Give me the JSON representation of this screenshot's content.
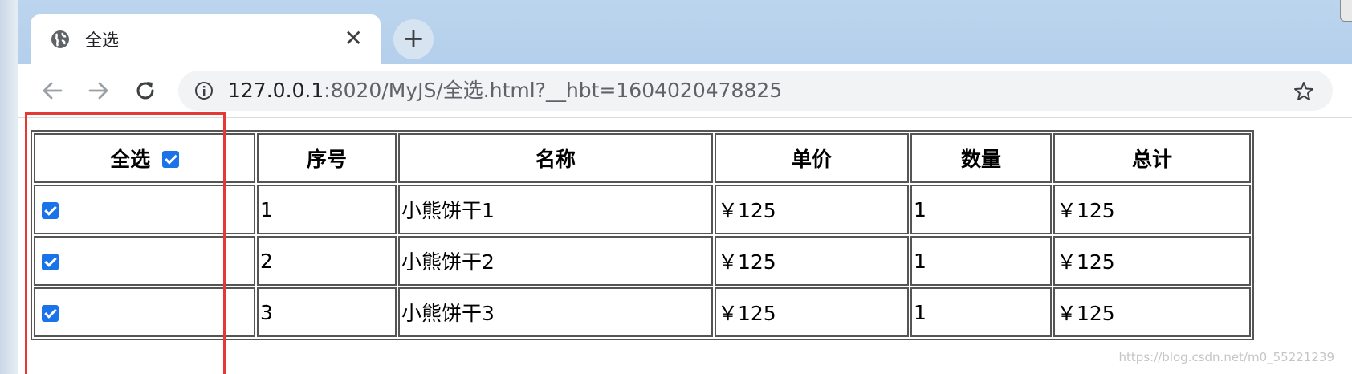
{
  "browser": {
    "tab": {
      "title": "全选",
      "close_glyph": "✕",
      "favicon_icon": "globe-icon"
    },
    "new_tab_glyph": "+",
    "address": {
      "host": "127.0.0.1",
      "path": ":8020/MyJS/全选.html?__hbt=1604020478825"
    }
  },
  "table": {
    "headers": {
      "select_all": "全选",
      "no": "序号",
      "name": "名称",
      "price": "单价",
      "qty": "数量",
      "total": "总计"
    },
    "select_all_checked": true,
    "rows": [
      {
        "checked": true,
        "no": "1",
        "name": "小熊饼干1",
        "price": "￥125",
        "qty": "1",
        "total": "￥125"
      },
      {
        "checked": true,
        "no": "2",
        "name": "小熊饼干2",
        "price": "￥125",
        "qty": "1",
        "total": "￥125"
      },
      {
        "checked": true,
        "no": "3",
        "name": "小熊饼干3",
        "price": "￥125",
        "qty": "1",
        "total": "￥125"
      }
    ]
  },
  "watermark": "https://blog.csdn.net/m0_55221239",
  "colors": {
    "checkbox": "#1a73e8",
    "highlight": "#e53935"
  }
}
